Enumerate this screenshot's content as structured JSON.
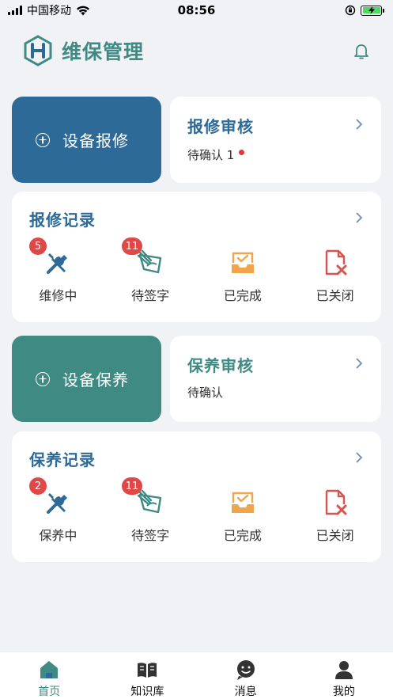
{
  "status_bar": {
    "carrier": "中国移动",
    "time": "08:56"
  },
  "header": {
    "title": "维保管理"
  },
  "repair": {
    "action_label": "设备报修",
    "review_title": "报修审核",
    "review_sub": "待确认 1",
    "records_title": "报修记录",
    "items": [
      {
        "label": "维修中",
        "badge": "5"
      },
      {
        "label": "待签字",
        "badge": "11"
      },
      {
        "label": "已完成",
        "badge": ""
      },
      {
        "label": "已关闭",
        "badge": ""
      }
    ]
  },
  "maintain": {
    "action_label": "设备保养",
    "review_title": "保养审核",
    "review_sub": "待确认",
    "records_title": "保养记录",
    "items": [
      {
        "label": "保养中",
        "badge": "2"
      },
      {
        "label": "待签字",
        "badge": "11"
      },
      {
        "label": "已完成",
        "badge": ""
      },
      {
        "label": "已关闭",
        "badge": ""
      }
    ]
  },
  "tabs": [
    {
      "label": "首页",
      "icon": "home-icon",
      "active": true
    },
    {
      "label": "知识库",
      "icon": "book-icon",
      "active": false
    },
    {
      "label": "消息",
      "icon": "message-icon",
      "active": false
    },
    {
      "label": "我的",
      "icon": "user-icon",
      "active": false
    }
  ],
  "colors": {
    "repair_tile": "#2d6a98",
    "maintain_tile": "#3f8a83",
    "badge": "#e04848",
    "done_icon": "#f0a44b",
    "closed_icon": "#d9534f"
  }
}
